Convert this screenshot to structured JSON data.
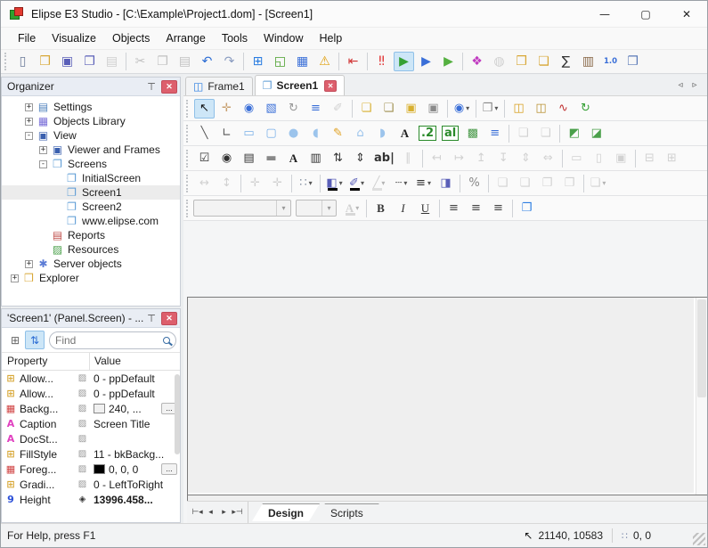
{
  "window": {
    "title": "Elipse E3 Studio  - [C:\\Example\\Project1.dom] - [Screen1]",
    "controls": [
      {
        "n": "minimize",
        "g": "—"
      },
      {
        "n": "maximize",
        "g": "▢"
      },
      {
        "n": "close",
        "g": "✕"
      }
    ]
  },
  "menu": {
    "items": [
      "File",
      "Visualize",
      "Objects",
      "Arrange",
      "Tools",
      "Window",
      "Help"
    ]
  },
  "toolbars": {
    "main": [
      {
        "n": "new-file",
        "g": "▯",
        "c": "#6b7a99"
      },
      {
        "n": "open-project",
        "g": "❒",
        "c": "#d8a838"
      },
      {
        "n": "save",
        "g": "▣",
        "c": "#5a5fb8"
      },
      {
        "n": "save-all",
        "g": "❐",
        "c": "#5a5fb8"
      },
      {
        "n": "print-setup",
        "g": "▤",
        "c": "#999",
        "s": "d"
      },
      {
        "sep": true
      },
      {
        "n": "cut",
        "g": "✂",
        "c": "#777",
        "s": "d"
      },
      {
        "n": "copy",
        "g": "❐",
        "c": "#777",
        "s": "d"
      },
      {
        "n": "paste",
        "g": "▤",
        "c": "#777",
        "s": "d"
      },
      {
        "n": "undo",
        "g": "↶",
        "c": "#2b6cd4"
      },
      {
        "n": "redo",
        "g": "↷",
        "c": "#8a9cc0"
      },
      {
        "sep": true
      },
      {
        "n": "insert-object",
        "g": "⊞",
        "c": "#2b7de1"
      },
      {
        "n": "insert-screen",
        "g": "◱",
        "c": "#4aa02c"
      },
      {
        "n": "insert-report",
        "g": "▦",
        "c": "#3a6fd8"
      },
      {
        "n": "verify-domain",
        "g": "⚠",
        "c": "#e0a010"
      },
      {
        "sep": true
      },
      {
        "n": "domain-options",
        "g": "⇤",
        "c": "#d03030"
      },
      {
        "sep": true
      },
      {
        "n": "stop-scripts",
        "g": "‼",
        "c": "#e03030"
      },
      {
        "n": "execute-domain",
        "g": "▶",
        "c": "#35a035",
        "s": "a"
      },
      {
        "n": "stop-domain",
        "g": "▶",
        "c": "#3a6fd8"
      },
      {
        "n": "run-viewer",
        "g": "▶",
        "c": "#55b040"
      },
      {
        "sep": true
      },
      {
        "n": "application-colors",
        "g": "❖",
        "c": "#c03ac0"
      },
      {
        "n": "database",
        "g": "◍",
        "c": "#999",
        "s": "d"
      },
      {
        "n": "search-in-files",
        "g": "❒",
        "c": "#d8a838"
      },
      {
        "n": "export-files",
        "g": "❏",
        "c": "#d8a838"
      },
      {
        "n": "expression-editor",
        "g": "∑",
        "c": "#333"
      },
      {
        "n": "documentation",
        "g": "▥",
        "c": "#8a6a4a"
      },
      {
        "n": "format-number",
        "g": "1.0",
        "c": "#3a6fd8",
        "sm": true,
        "bx": false
      },
      {
        "n": "find-windows",
        "g": "❐",
        "c": "#5a7ab8"
      }
    ],
    "edit1": [
      {
        "n": "select-tool",
        "g": "↖",
        "c": "#111",
        "s": "a"
      },
      {
        "n": "pan-tool",
        "g": "✛",
        "c": "#c8a070"
      },
      {
        "n": "zoom-tool",
        "g": "◉",
        "c": "#3a6fd8"
      },
      {
        "n": "zoom-region-tool",
        "g": "▧",
        "c": "#3a6fd8"
      },
      {
        "n": "rotate-tool",
        "g": "↻",
        "c": "#999"
      },
      {
        "n": "tab-order",
        "g": "≡",
        "c": "#3a6fd8"
      },
      {
        "n": "remove-associations",
        "g": "✐",
        "c": "#999",
        "s": "d"
      },
      {
        "sep": true
      },
      {
        "n": "bring-to-front",
        "g": "❏",
        "c": "#d8b030"
      },
      {
        "n": "send-to-back",
        "g": "❏",
        "c": "#a09050"
      },
      {
        "n": "bring-forward",
        "g": "▣",
        "c": "#d8b030"
      },
      {
        "n": "send-backward",
        "g": "▣",
        "c": "#8a8a8a"
      },
      {
        "sep": true
      },
      {
        "n": "zoom-level",
        "g": "◉",
        "c": "#3a6fd8",
        "dd": true
      },
      {
        "sep": true
      },
      {
        "n": "group-objects",
        "g": "❐",
        "c": "#888",
        "dd": true
      },
      {
        "sep": true
      },
      {
        "n": "insert-gallery",
        "g": "◫",
        "c": "#d8a020"
      },
      {
        "n": "insert-e3query",
        "g": "◫",
        "c": "#b89030"
      },
      {
        "n": "insert-chart",
        "g": "∿",
        "c": "#c03030"
      },
      {
        "n": "screen-update",
        "g": "↻",
        "c": "#35a035"
      }
    ],
    "edit2": [
      {
        "n": "line-tool",
        "g": "╲",
        "c": "#555"
      },
      {
        "n": "polyline-tool",
        "g": "∟",
        "c": "#555"
      },
      {
        "n": "rectangle-tool",
        "g": "▭",
        "c": "#7ab0e8"
      },
      {
        "n": "rounded-rectangle-tool",
        "g": "▢",
        "c": "#7ab0e8"
      },
      {
        "n": "ellipse-tool",
        "g": "●",
        "c": "#9cc4ec"
      },
      {
        "n": "pie-tool",
        "g": "◖",
        "c": "#9cc4ec"
      },
      {
        "n": "pencil-tool",
        "g": "✎",
        "c": "#e0a020"
      },
      {
        "n": "polygon-tool",
        "g": "⌂",
        "c": "#9cc4ec"
      },
      {
        "n": "closed-curve-tool",
        "g": "◗",
        "c": "#9cc4ec"
      },
      {
        "n": "text-tool",
        "g": "A",
        "c": "#222",
        "st": "b"
      },
      {
        "n": "display-tool",
        "g": ".2",
        "c": "#2a8a2a",
        "sm": true,
        "bx": true
      },
      {
        "n": "textbox-tool",
        "g": "al",
        "c": "#2a8a2a",
        "sm": true,
        "bx": true
      },
      {
        "n": "picture-tool",
        "g": "▩",
        "c": "#4a9a4a"
      },
      {
        "n": "scale-tool",
        "g": "≡",
        "c": "#3a6fd8"
      },
      {
        "sep": true
      },
      {
        "n": "group",
        "g": "❏",
        "c": "#999",
        "s": "d"
      },
      {
        "n": "ungroup",
        "g": "❏",
        "c": "#999",
        "s": "d"
      },
      {
        "sep": true
      },
      {
        "n": "create-links",
        "g": "◩",
        "c": "#4aa04a"
      },
      {
        "n": "paste-links",
        "g": "◪",
        "c": "#4aa04a"
      }
    ],
    "edit3": [
      {
        "n": "checkbox-control",
        "g": "☑",
        "c": "#333"
      },
      {
        "n": "radio-control",
        "g": "◉",
        "c": "#333"
      },
      {
        "n": "listbox-control",
        "g": "▤",
        "c": "#333"
      },
      {
        "n": "button-control",
        "g": "▬",
        "c": "#888"
      },
      {
        "n": "label-control",
        "g": "A",
        "c": "#222",
        "st": "b"
      },
      {
        "n": "combobox-control",
        "g": "▥",
        "c": "#333"
      },
      {
        "n": "spin-control",
        "g": "⇅",
        "c": "#333"
      },
      {
        "n": "slider-control",
        "g": "⇕",
        "c": "#333"
      },
      {
        "n": "textbox-control",
        "g": "ab|",
        "c": "#333",
        "sm": true
      },
      {
        "n": "frame-control",
        "g": "∥",
        "c": "#c09090",
        "s": "d"
      },
      {
        "sep": true
      },
      {
        "n": "align-left",
        "g": "↤",
        "c": "#999",
        "s": "d"
      },
      {
        "n": "align-right",
        "g": "↦",
        "c": "#999",
        "s": "d"
      },
      {
        "n": "align-top",
        "g": "↥",
        "c": "#999",
        "s": "d"
      },
      {
        "n": "align-bottom",
        "g": "↧",
        "c": "#999",
        "s": "d"
      },
      {
        "n": "center-vertically",
        "g": "⇕",
        "c": "#999",
        "s": "d"
      },
      {
        "n": "center-horizontally",
        "g": "⇔",
        "c": "#999",
        "s": "d"
      },
      {
        "sep": true
      },
      {
        "n": "same-width",
        "g": "▭",
        "c": "#999",
        "s": "d"
      },
      {
        "n": "same-height",
        "g": "▯",
        "c": "#999",
        "s": "d"
      },
      {
        "n": "same-size",
        "g": "▣",
        "c": "#999",
        "s": "d"
      },
      {
        "sep": true
      },
      {
        "n": "center-horizontal-screen",
        "g": "⊟",
        "c": "#999",
        "s": "d"
      },
      {
        "n": "center-vertical-screen",
        "g": "⊞",
        "c": "#999",
        "s": "d"
      }
    ],
    "edit4": [
      {
        "n": "equal-horizontal-spacing",
        "g": "↔",
        "c": "#999",
        "s": "d"
      },
      {
        "n": "equal-vertical-spacing",
        "g": "↕",
        "c": "#999",
        "s": "d"
      },
      {
        "sep": true
      },
      {
        "n": "nudge-horizontal",
        "g": "✛",
        "c": "#999",
        "s": "d"
      },
      {
        "n": "nudge-vertical",
        "g": "✛",
        "c": "#999",
        "s": "d"
      },
      {
        "sep": true
      },
      {
        "n": "grid-options",
        "g": "∷",
        "c": "#8a95a5",
        "dd": true
      },
      {
        "sep": true
      },
      {
        "n": "fill-color",
        "g": "◧",
        "c": "#5a5fb8",
        "bar": "#000000",
        "dd": true
      },
      {
        "n": "brush-color",
        "g": "✐",
        "c": "#5a5fb8",
        "bar": "#000000",
        "dd": true
      },
      {
        "n": "line-color",
        "g": "╱",
        "c": "#999",
        "bar": "#bbbbbb",
        "s": "d",
        "dd": true
      },
      {
        "n": "line-style",
        "g": "┄",
        "c": "#777",
        "dd": true
      },
      {
        "n": "line-width",
        "g": "≡",
        "c": "#333",
        "dd": true
      },
      {
        "n": "background-style",
        "g": "◨",
        "c": "#5a5fb8"
      },
      {
        "sep": true
      },
      {
        "n": "transparency",
        "g": "%",
        "c": "#888"
      },
      {
        "sep": true
      },
      {
        "n": "raise-3d",
        "g": "❏",
        "c": "#999",
        "s": "d"
      },
      {
        "n": "sink-3d",
        "g": "❏",
        "c": "#999",
        "s": "d"
      },
      {
        "n": "shadow-object",
        "g": "❐",
        "c": "#999",
        "s": "d"
      },
      {
        "n": "offset-object",
        "g": "❐",
        "c": "#999",
        "s": "d"
      },
      {
        "sep": true
      },
      {
        "n": "object-position",
        "g": "❏",
        "c": "#999",
        "s": "d",
        "dd": true
      }
    ],
    "edit5": [
      {
        "n": "font-color",
        "g": "A",
        "c": "#999",
        "bar": "#aaaaaa",
        "s": "d",
        "dd": true,
        "st": "b"
      },
      {
        "sep": true
      },
      {
        "n": "bold",
        "g": "B",
        "c": "#333",
        "st": "b"
      },
      {
        "n": "italic",
        "g": "I",
        "c": "#333",
        "st": "i"
      },
      {
        "n": "underline",
        "g": "U",
        "c": "#333",
        "st": "u"
      },
      {
        "sep": true
      },
      {
        "n": "align-text-left",
        "g": "≡",
        "c": "#444"
      },
      {
        "n": "align-text-center",
        "g": "≡",
        "c": "#444"
      },
      {
        "n": "align-text-right",
        "g": "≡",
        "c": "#444"
      },
      {
        "sep": true
      },
      {
        "n": "screen-properties",
        "g": "❐",
        "c": "#2b7de1"
      }
    ]
  },
  "organizer": {
    "title": "Organizer",
    "tree": [
      {
        "label": "Settings",
        "level": 1,
        "exp": "+",
        "glyph": "▤",
        "color": "#4f81bd"
      },
      {
        "label": "Objects Library",
        "level": 1,
        "exp": "+",
        "glyph": "▦",
        "color": "#7a6fd8"
      },
      {
        "label": "View",
        "level": 1,
        "exp": "-",
        "glyph": "▣",
        "color": "#3a5fae"
      },
      {
        "label": "Viewer and Frames",
        "level": 2,
        "exp": "+",
        "glyph": "▣",
        "color": "#3a5fae"
      },
      {
        "label": "Screens",
        "level": 2,
        "exp": "-",
        "glyph": "❐",
        "color": "#5b9bd5"
      },
      {
        "label": "InitialScreen",
        "level": 3,
        "exp": "",
        "glyph": "❐",
        "color": "#5b9bd5"
      },
      {
        "label": "Screen1",
        "level": 3,
        "exp": "",
        "glyph": "❐",
        "color": "#5b9bd5",
        "selected": true
      },
      {
        "label": "Screen2",
        "level": 3,
        "exp": "",
        "glyph": "❐",
        "color": "#5b9bd5"
      },
      {
        "label": "www.elipse.com",
        "level": 3,
        "exp": "",
        "glyph": "❐",
        "color": "#5b9bd5"
      },
      {
        "label": "Reports",
        "level": 2,
        "exp": "",
        "glyph": "▤",
        "color": "#c0504d"
      },
      {
        "label": "Resources",
        "level": 2,
        "exp": "",
        "glyph": "▨",
        "color": "#4aa04a"
      },
      {
        "label": "Server objects",
        "level": 1,
        "exp": "+",
        "glyph": "✱",
        "color": "#5b7bd5"
      },
      {
        "label": "Explorer",
        "level": 0,
        "exp": "+",
        "glyph": "❒",
        "color": "#d8a838"
      }
    ]
  },
  "properties_panel": {
    "title": "'Screen1' (Panel.Screen) - ...",
    "find_placeholder": "Find",
    "col_property": "Property",
    "col_value": "Value",
    "rows": [
      {
        "icon": "enum",
        "name": "Allow...",
        "mid": "▨",
        "value": "0 - ppDefault"
      },
      {
        "icon": "enum",
        "name": "Allow...",
        "mid": "▨",
        "value": "0 - ppDefault"
      },
      {
        "icon": "color",
        "name": "Backg...",
        "mid": "▨",
        "swatch": "#f0f0f0",
        "value": "240, ...",
        "btn": true
      },
      {
        "icon": "string",
        "name": "Caption",
        "mid": "▨",
        "value": "Screen Title"
      },
      {
        "icon": "string",
        "name": "DocSt...",
        "mid": "▨",
        "value": ""
      },
      {
        "icon": "enum",
        "name": "FillStyle",
        "mid": "▨",
        "value": "11 - bkBackg..."
      },
      {
        "icon": "color",
        "name": "Foreg...",
        "mid": "▨",
        "swatch": "#000000",
        "value": "0, 0, 0",
        "btn": true
      },
      {
        "icon": "enum",
        "name": "Gradi...",
        "mid": "▨",
        "value": "0 - LeftToRight"
      },
      {
        "icon": "number",
        "name": "Height",
        "mid": "◈",
        "value": "13996.458...",
        "bold": true
      }
    ],
    "icon_styles": {
      "enum": {
        "glyph": "⊞",
        "color": "#d8a838"
      },
      "color": {
        "glyph": "▦",
        "color": "#d04040"
      },
      "string": {
        "glyph": "A",
        "color": "#e040c0"
      },
      "number": {
        "glyph": "9",
        "color": "#2b4fd8"
      }
    }
  },
  "document_tabs": {
    "tabs": [
      {
        "label": "Frame1",
        "icon": "◫",
        "icon_color": "#2b7de1",
        "active": false,
        "closable": false
      },
      {
        "label": "Screen1",
        "icon": "❐",
        "icon_color": "#5b9bd5",
        "active": true,
        "closable": true
      }
    ],
    "close_glyph": "✕",
    "nav": [
      {
        "n": "scroll-tabs-left",
        "g": "◃"
      },
      {
        "n": "scroll-tabs-right",
        "g": "▹"
      }
    ]
  },
  "bottom_bar": {
    "nav": [
      {
        "n": "first-sheet",
        "g": "⊢◂"
      },
      {
        "n": "prev-sheet",
        "g": "◂"
      },
      {
        "n": "next-sheet",
        "g": "▸"
      },
      {
        "n": "last-sheet",
        "g": "▸⊣"
      }
    ],
    "tabs": [
      {
        "label": "Design",
        "active": true
      },
      {
        "label": "Scripts",
        "active": false
      }
    ]
  },
  "status_bar": {
    "help_text": "For Help, press F1",
    "cursor_glyph": "↖",
    "cursor_coords": "21140, 10583",
    "grid_glyph": "∷",
    "grid_coords": "0, 0"
  }
}
